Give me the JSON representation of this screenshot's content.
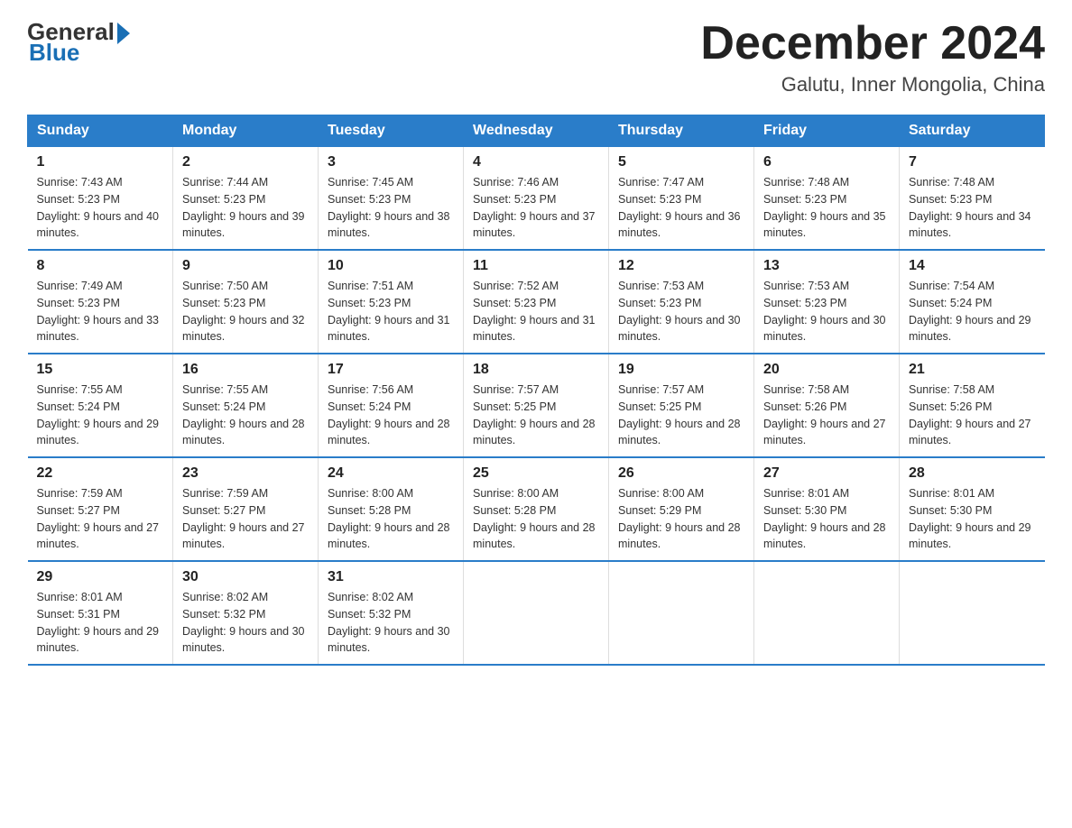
{
  "logo": {
    "general": "General",
    "blue": "Blue"
  },
  "title": "December 2024",
  "subtitle": "Galutu, Inner Mongolia, China",
  "days_of_week": [
    "Sunday",
    "Monday",
    "Tuesday",
    "Wednesday",
    "Thursday",
    "Friday",
    "Saturday"
  ],
  "weeks": [
    [
      {
        "day": "1",
        "sunrise": "7:43 AM",
        "sunset": "5:23 PM",
        "daylight": "9 hours and 40 minutes."
      },
      {
        "day": "2",
        "sunrise": "7:44 AM",
        "sunset": "5:23 PM",
        "daylight": "9 hours and 39 minutes."
      },
      {
        "day": "3",
        "sunrise": "7:45 AM",
        "sunset": "5:23 PM",
        "daylight": "9 hours and 38 minutes."
      },
      {
        "day": "4",
        "sunrise": "7:46 AM",
        "sunset": "5:23 PM",
        "daylight": "9 hours and 37 minutes."
      },
      {
        "day": "5",
        "sunrise": "7:47 AM",
        "sunset": "5:23 PM",
        "daylight": "9 hours and 36 minutes."
      },
      {
        "day": "6",
        "sunrise": "7:48 AM",
        "sunset": "5:23 PM",
        "daylight": "9 hours and 35 minutes."
      },
      {
        "day": "7",
        "sunrise": "7:48 AM",
        "sunset": "5:23 PM",
        "daylight": "9 hours and 34 minutes."
      }
    ],
    [
      {
        "day": "8",
        "sunrise": "7:49 AM",
        "sunset": "5:23 PM",
        "daylight": "9 hours and 33 minutes."
      },
      {
        "day": "9",
        "sunrise": "7:50 AM",
        "sunset": "5:23 PM",
        "daylight": "9 hours and 32 minutes."
      },
      {
        "day": "10",
        "sunrise": "7:51 AM",
        "sunset": "5:23 PM",
        "daylight": "9 hours and 31 minutes."
      },
      {
        "day": "11",
        "sunrise": "7:52 AM",
        "sunset": "5:23 PM",
        "daylight": "9 hours and 31 minutes."
      },
      {
        "day": "12",
        "sunrise": "7:53 AM",
        "sunset": "5:23 PM",
        "daylight": "9 hours and 30 minutes."
      },
      {
        "day": "13",
        "sunrise": "7:53 AM",
        "sunset": "5:23 PM",
        "daylight": "9 hours and 30 minutes."
      },
      {
        "day": "14",
        "sunrise": "7:54 AM",
        "sunset": "5:24 PM",
        "daylight": "9 hours and 29 minutes."
      }
    ],
    [
      {
        "day": "15",
        "sunrise": "7:55 AM",
        "sunset": "5:24 PM",
        "daylight": "9 hours and 29 minutes."
      },
      {
        "day": "16",
        "sunrise": "7:55 AM",
        "sunset": "5:24 PM",
        "daylight": "9 hours and 28 minutes."
      },
      {
        "day": "17",
        "sunrise": "7:56 AM",
        "sunset": "5:24 PM",
        "daylight": "9 hours and 28 minutes."
      },
      {
        "day": "18",
        "sunrise": "7:57 AM",
        "sunset": "5:25 PM",
        "daylight": "9 hours and 28 minutes."
      },
      {
        "day": "19",
        "sunrise": "7:57 AM",
        "sunset": "5:25 PM",
        "daylight": "9 hours and 28 minutes."
      },
      {
        "day": "20",
        "sunrise": "7:58 AM",
        "sunset": "5:26 PM",
        "daylight": "9 hours and 27 minutes."
      },
      {
        "day": "21",
        "sunrise": "7:58 AM",
        "sunset": "5:26 PM",
        "daylight": "9 hours and 27 minutes."
      }
    ],
    [
      {
        "day": "22",
        "sunrise": "7:59 AM",
        "sunset": "5:27 PM",
        "daylight": "9 hours and 27 minutes."
      },
      {
        "day": "23",
        "sunrise": "7:59 AM",
        "sunset": "5:27 PM",
        "daylight": "9 hours and 27 minutes."
      },
      {
        "day": "24",
        "sunrise": "8:00 AM",
        "sunset": "5:28 PM",
        "daylight": "9 hours and 28 minutes."
      },
      {
        "day": "25",
        "sunrise": "8:00 AM",
        "sunset": "5:28 PM",
        "daylight": "9 hours and 28 minutes."
      },
      {
        "day": "26",
        "sunrise": "8:00 AM",
        "sunset": "5:29 PM",
        "daylight": "9 hours and 28 minutes."
      },
      {
        "day": "27",
        "sunrise": "8:01 AM",
        "sunset": "5:30 PM",
        "daylight": "9 hours and 28 minutes."
      },
      {
        "day": "28",
        "sunrise": "8:01 AM",
        "sunset": "5:30 PM",
        "daylight": "9 hours and 29 minutes."
      }
    ],
    [
      {
        "day": "29",
        "sunrise": "8:01 AM",
        "sunset": "5:31 PM",
        "daylight": "9 hours and 29 minutes."
      },
      {
        "day": "30",
        "sunrise": "8:02 AM",
        "sunset": "5:32 PM",
        "daylight": "9 hours and 30 minutes."
      },
      {
        "day": "31",
        "sunrise": "8:02 AM",
        "sunset": "5:32 PM",
        "daylight": "9 hours and 30 minutes."
      },
      null,
      null,
      null,
      null
    ]
  ]
}
